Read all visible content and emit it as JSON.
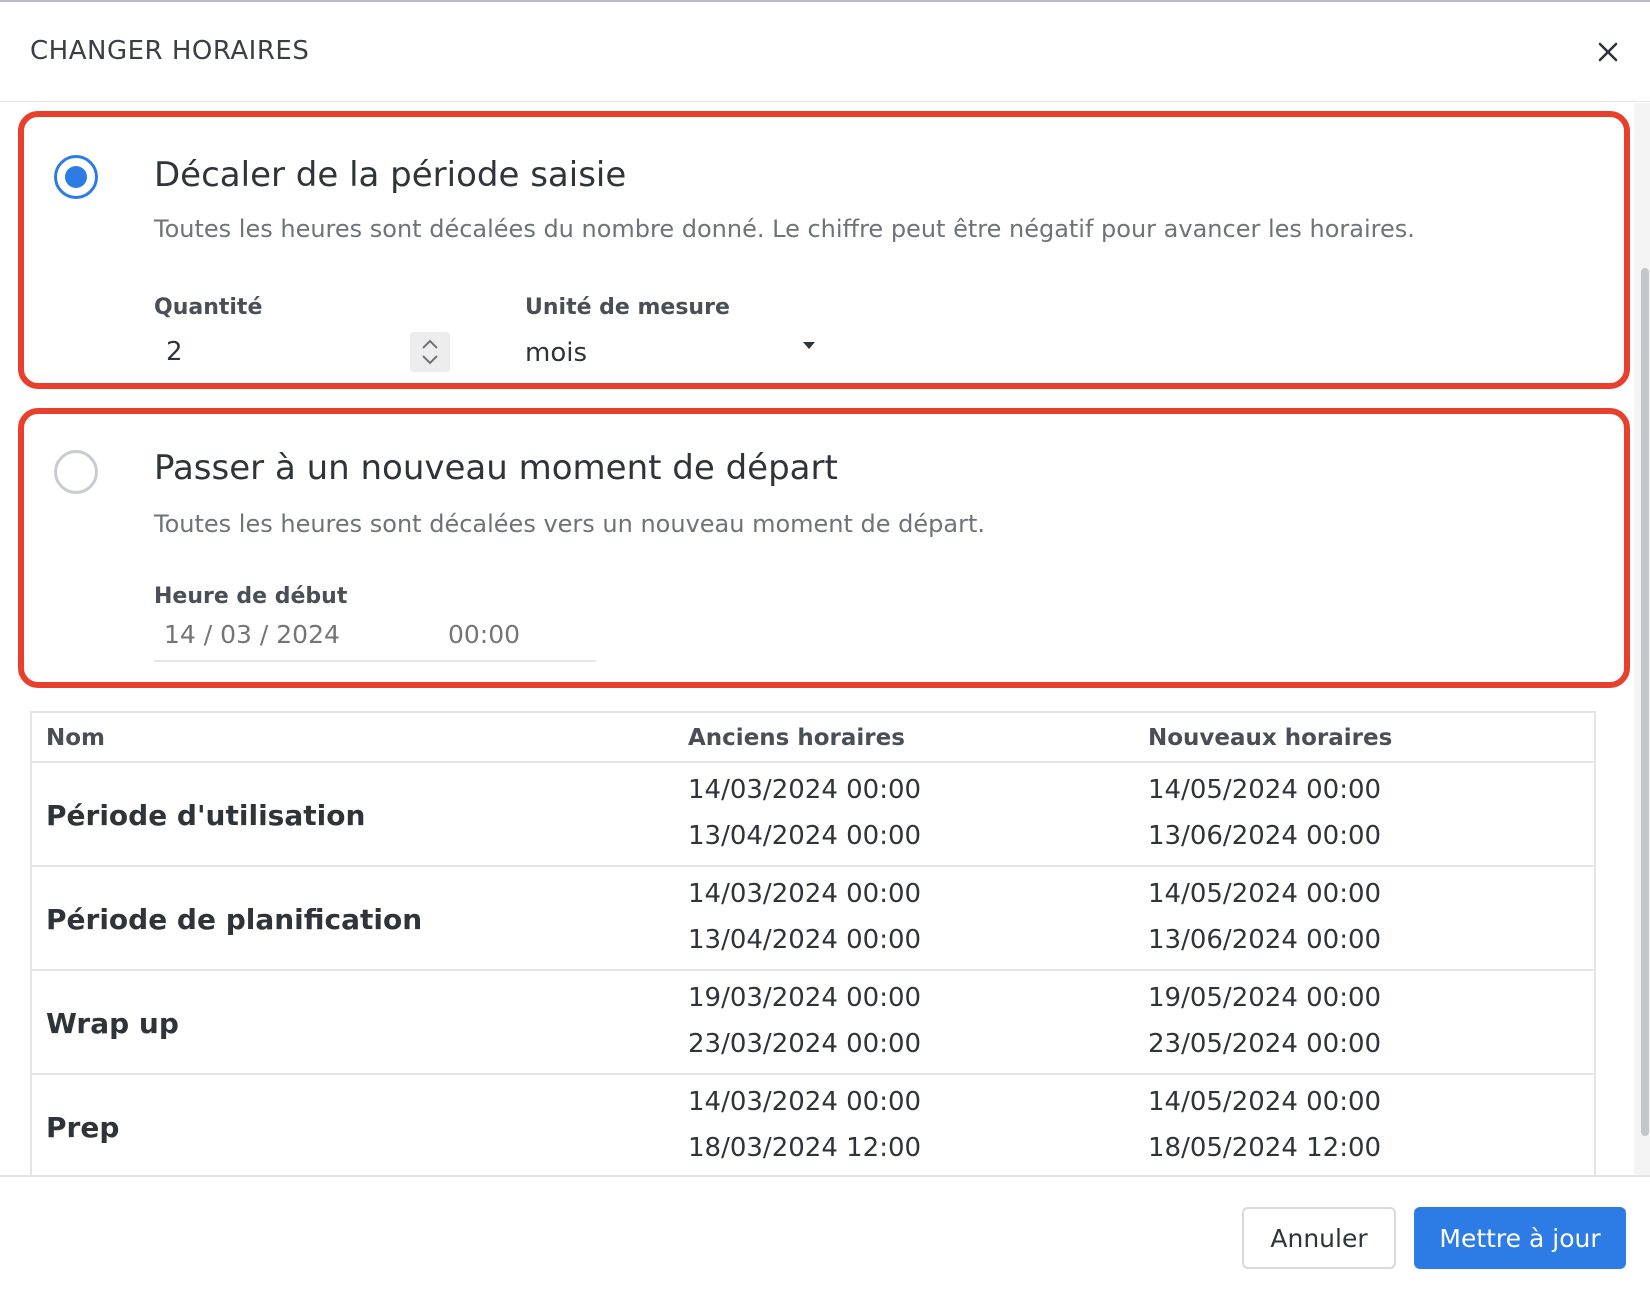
{
  "dialog": {
    "title": "CHANGER HORAIRES",
    "close_icon": "close-icon"
  },
  "option_shift": {
    "selected": true,
    "title": "Décaler de la période saisie",
    "description": "Toutes les heures sont décalées du nombre donné. Le chiffre peut être négatif pour avancer les horaires.",
    "quantity_label": "Quantité",
    "quantity_value": "2",
    "unit_label": "Unité de mesure",
    "unit_value": "mois"
  },
  "option_new_start": {
    "selected": false,
    "title": "Passer à un nouveau moment de départ",
    "description": "Toutes les heures sont décalées vers un nouveau moment de départ.",
    "start_label": "Heure de début",
    "date_placeholder": "14 / 03 / 2024",
    "time_placeholder": "00:00"
  },
  "table": {
    "headers": [
      "Nom",
      "Anciens horaires",
      "Nouveaux horaires"
    ],
    "rows": [
      {
        "name": "Période d'utilisation",
        "old_start": "14/03/2024 00:00",
        "old_end": "13/04/2024 00:00",
        "new_start": "14/05/2024 00:00",
        "new_end": "13/06/2024 00:00"
      },
      {
        "name": "Période de planification",
        "old_start": "14/03/2024 00:00",
        "old_end": "13/04/2024 00:00",
        "new_start": "14/05/2024 00:00",
        "new_end": "13/06/2024 00:00"
      },
      {
        "name": "Wrap up",
        "old_start": "19/03/2024 00:00",
        "old_end": "23/03/2024 00:00",
        "new_start": "19/05/2024 00:00",
        "new_end": "23/05/2024 00:00"
      },
      {
        "name": "Prep",
        "old_start": "14/03/2024 00:00",
        "old_end": "18/03/2024 12:00",
        "new_start": "14/05/2024 00:00",
        "new_end": "18/05/2024 12:00"
      }
    ]
  },
  "footer": {
    "cancel_label": "Annuler",
    "update_label": "Mettre à jour"
  },
  "colors": {
    "accent": "#2d7be5",
    "highlight": "#e8402d"
  }
}
